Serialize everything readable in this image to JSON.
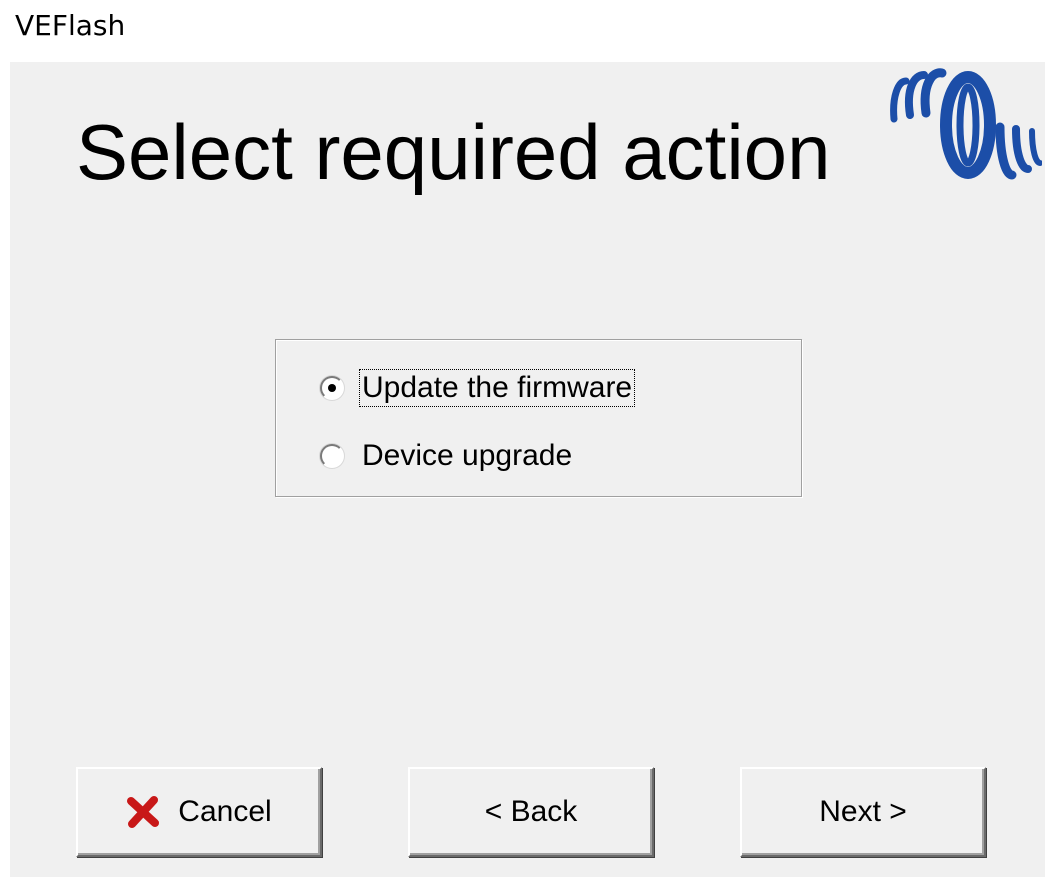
{
  "app": {
    "title": "VEFlash"
  },
  "page": {
    "heading": "Select required action"
  },
  "options": [
    {
      "label": "Update the firmware",
      "selected": true
    },
    {
      "label": "Device upgrade",
      "selected": false
    }
  ],
  "buttons": {
    "cancel": "Cancel",
    "back": "< Back",
    "next": "Next >"
  },
  "icons": {
    "logo": "victron-energy-logo",
    "cancel": "red-x-icon"
  },
  "colors": {
    "logo_blue": "#1c4ea8",
    "cancel_red": "#c81818",
    "panel_bg": "#f0f0f0"
  }
}
